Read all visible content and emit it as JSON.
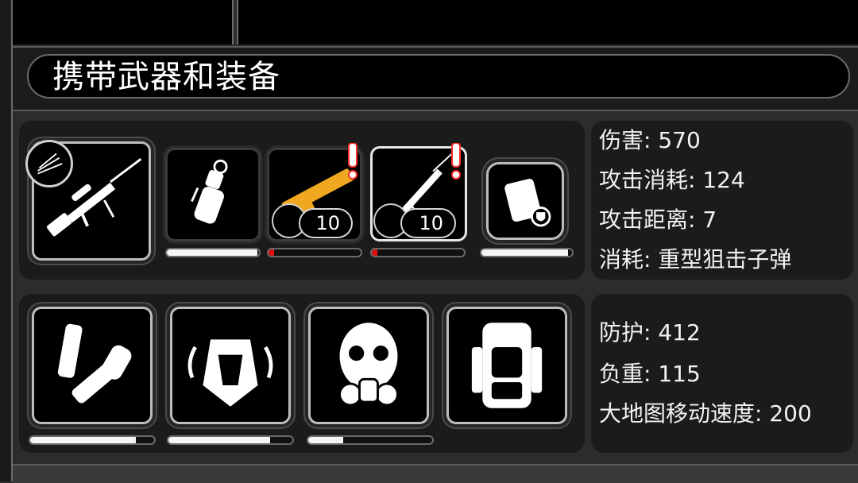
{
  "section_title": "携带武器和装备",
  "weapons": {
    "slots": [
      {
        "name": "sniper-rifle",
        "durability": 0.98
      },
      {
        "name": "stun-grenade",
        "durability": 0.98
      },
      {
        "name": "golden-shotgun",
        "ammo": "10",
        "durability": 0.06,
        "warning": true
      },
      {
        "name": "rifle-with-bayonet",
        "ammo": "10",
        "durability": 0.06,
        "warning": true
      },
      {
        "name": "armor-plate",
        "durability": 0.96
      }
    ]
  },
  "weapon_stats": {
    "damage": "伤害: 570",
    "attack_cost": "攻击消耗: 124",
    "attack_range": "攻击距离: 7",
    "consumes": "消耗: 重型狙击子弹"
  },
  "equipment": {
    "slots": [
      {
        "name": "boots-gear",
        "durability": 0.85
      },
      {
        "name": "body-armor",
        "durability": 0.82
      },
      {
        "name": "gas-mask",
        "durability": 0.28
      },
      {
        "name": "backpack",
        "durability": null
      }
    ]
  },
  "equipment_stats": {
    "protection": "防护: 412",
    "load": "负重: 115",
    "map_speed": "大地图移动速度: 200"
  },
  "colors": {
    "accent_red": "#e01010",
    "gold": "#f0a820",
    "warning": "#ff2a2a"
  }
}
